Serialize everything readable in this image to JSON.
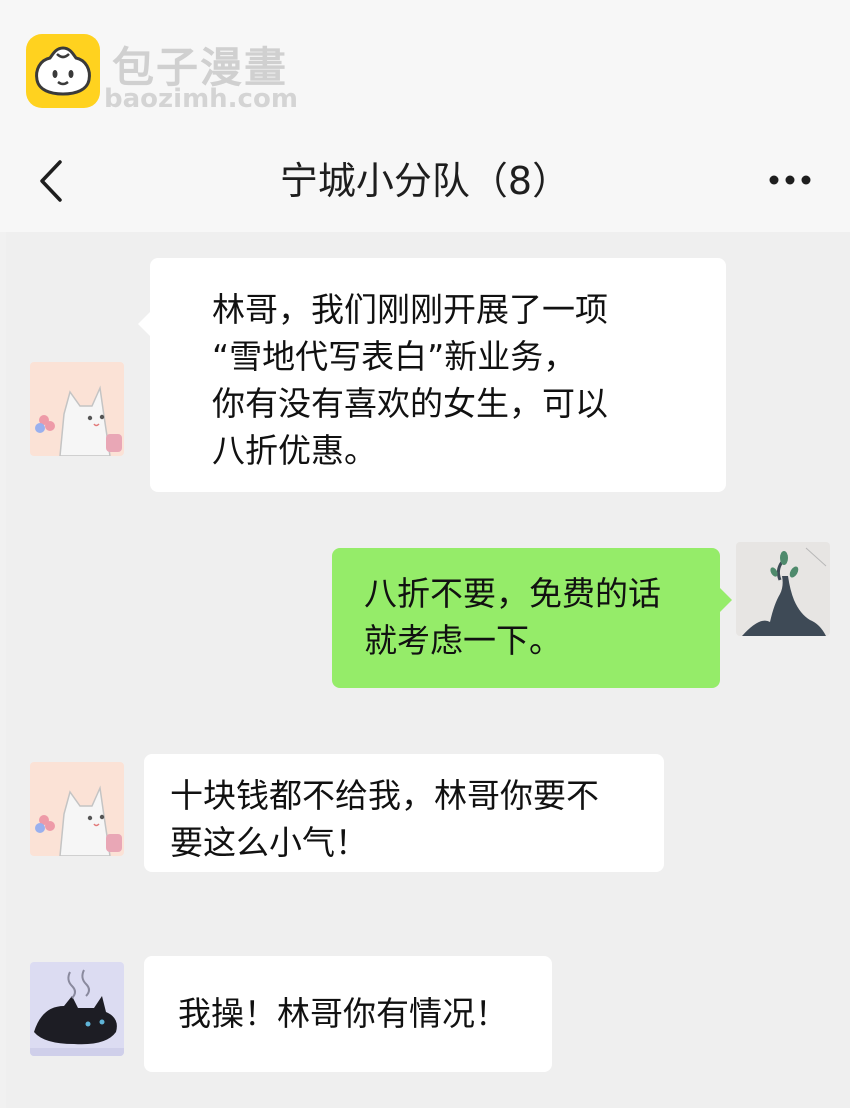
{
  "watermark": {
    "title": "包子漫畫",
    "url": "baozimh.com"
  },
  "header": {
    "title": "宁城小分队（8）",
    "back_icon": "chevron-left-icon",
    "more_icon": "more-dots-icon"
  },
  "messages": [
    {
      "side": "left",
      "avatar": "white-cat-avatar",
      "bubble_color": "#ffffff",
      "lines": [
        "林哥，我们刚刚开展了一项",
        "“雪地代写表白”新业务，",
        "你有没有喜欢的女生，可以",
        "八折优惠。"
      ]
    },
    {
      "side": "right",
      "avatar": "tree-avatar",
      "bubble_color": "#95ec69",
      "lines": [
        "八折不要，免费的话",
        "就考虑一下。"
      ]
    },
    {
      "side": "left",
      "avatar": "white-cat-avatar",
      "bubble_color": "#ffffff",
      "lines": [
        "十块钱都不给我，林哥你要不",
        "要这么小气！"
      ]
    },
    {
      "side": "left",
      "avatar": "black-cat-avatar",
      "bubble_color": "#ffffff",
      "lines": [
        "我操！林哥你有情况！"
      ]
    }
  ]
}
